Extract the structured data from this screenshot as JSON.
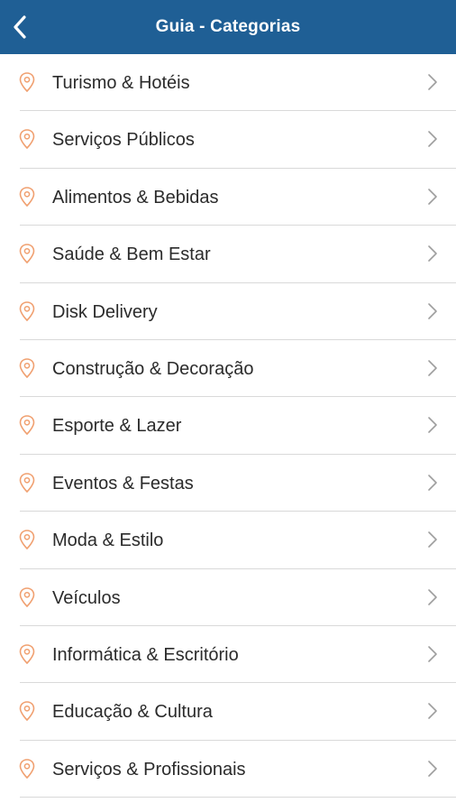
{
  "header": {
    "title": "Guia - Categorias",
    "back_icon": "chevron-left-icon",
    "background_color": "#1f5f95"
  },
  "list": {
    "item_icon": "map-pin-icon",
    "item_icon_color": "#f0a070",
    "trailing_icon": "chevron-right-icon",
    "items": [
      {
        "label": "Turismo & Hotéis"
      },
      {
        "label": "Serviços Públicos"
      },
      {
        "label": "Alimentos & Bebidas"
      },
      {
        "label": "Saúde & Bem Estar"
      },
      {
        "label": "Disk Delivery"
      },
      {
        "label": "Construção & Decoração"
      },
      {
        "label": "Esporte & Lazer"
      },
      {
        "label": "Eventos & Festas"
      },
      {
        "label": "Moda & Estilo"
      },
      {
        "label": "Veículos"
      },
      {
        "label": "Informática & Escritório"
      },
      {
        "label": "Educação & Cultura"
      },
      {
        "label": "Serviços & Profissionais"
      }
    ]
  }
}
